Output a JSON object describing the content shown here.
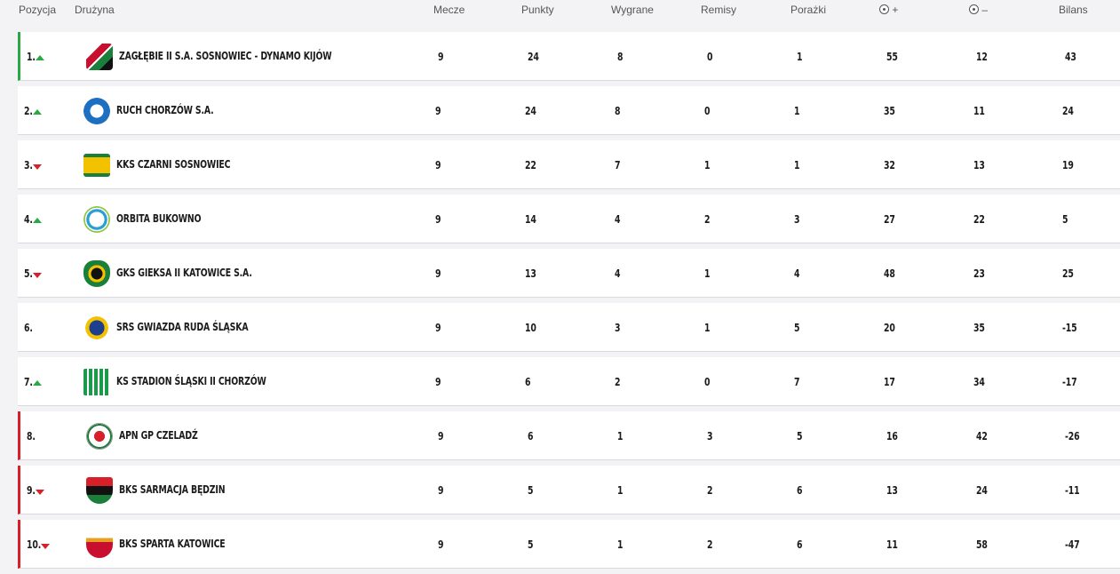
{
  "header": {
    "pozycja": "Pozycja",
    "druzyna": "Drużyna",
    "mecze": "Mecze",
    "punkty": "Punkty",
    "wygrane": "Wygrane",
    "remisy": "Remisy",
    "porazki": "Porażki",
    "goals_for": "+",
    "goals_against": "–",
    "bilans": "Bilans"
  },
  "rows": [
    {
      "pos": "1.",
      "trend": "up",
      "zone": "promo",
      "team": "ZAGŁĘBIE II S.A. SOSNOWIEC - DYNAMO KIJÓW",
      "logo": "zaglebie-logo",
      "mecze": "9",
      "punkty": "24",
      "wygrane": "8",
      "remisy": "0",
      "porazki": "1",
      "gplus": "55",
      "gminus": "12",
      "bilans": "43"
    },
    {
      "pos": "2.",
      "trend": "up",
      "zone": "",
      "team": "RUCH CHORZÓW S.A.",
      "logo": "ruch-logo",
      "mecze": "9",
      "punkty": "24",
      "wygrane": "8",
      "remisy": "0",
      "porazki": "1",
      "gplus": "35",
      "gminus": "11",
      "bilans": "24"
    },
    {
      "pos": "3.",
      "trend": "down",
      "zone": "",
      "team": "KKS CZARNI SOSNOWIEC",
      "logo": "czarni-logo",
      "mecze": "9",
      "punkty": "22",
      "wygrane": "7",
      "remisy": "1",
      "porazki": "1",
      "gplus": "32",
      "gminus": "13",
      "bilans": "19"
    },
    {
      "pos": "4.",
      "trend": "up",
      "zone": "",
      "team": "ORBITA BUKOWNO",
      "logo": "orbita-logo",
      "mecze": "9",
      "punkty": "14",
      "wygrane": "4",
      "remisy": "2",
      "porazki": "3",
      "gplus": "27",
      "gminus": "22",
      "bilans": "5"
    },
    {
      "pos": "5.",
      "trend": "down",
      "zone": "",
      "team": "GKS GIEKSA II KATOWICE S.A.",
      "logo": "gieksa-logo",
      "mecze": "9",
      "punkty": "13",
      "wygrane": "4",
      "remisy": "1",
      "porazki": "4",
      "gplus": "48",
      "gminus": "23",
      "bilans": "25"
    },
    {
      "pos": "6.",
      "trend": "",
      "zone": "",
      "team": "SRS GWIAZDA RUDA ŚLĄSKA",
      "logo": "gwiazda-logo",
      "mecze": "9",
      "punkty": "10",
      "wygrane": "3",
      "remisy": "1",
      "porazki": "5",
      "gplus": "20",
      "gminus": "35",
      "bilans": "-15"
    },
    {
      "pos": "7.",
      "trend": "up",
      "zone": "",
      "team": "KS STADION ŚLĄSKI II CHORZÓW",
      "logo": "stadion-logo",
      "mecze": "9",
      "punkty": "6",
      "wygrane": "2",
      "remisy": "0",
      "porazki": "7",
      "gplus": "17",
      "gminus": "34",
      "bilans": "-17"
    },
    {
      "pos": "8.",
      "trend": "",
      "zone": "releg",
      "team": "APN GP CZELADŹ",
      "logo": "apn-logo",
      "mecze": "9",
      "punkty": "6",
      "wygrane": "1",
      "remisy": "3",
      "porazki": "5",
      "gplus": "16",
      "gminus": "42",
      "bilans": "-26"
    },
    {
      "pos": "9.",
      "trend": "down",
      "zone": "releg",
      "team": "BKS SARMACJA BĘDZIN",
      "logo": "sarmacja-logo",
      "mecze": "9",
      "punkty": "5",
      "wygrane": "1",
      "remisy": "2",
      "porazki": "6",
      "gplus": "13",
      "gminus": "24",
      "bilans": "-11"
    },
    {
      "pos": "10.",
      "trend": "down",
      "zone": "releg",
      "team": "BKS SPARTA KATOWICE",
      "logo": "sparta-logo",
      "mecze": "9",
      "punkty": "5",
      "wygrane": "1",
      "remisy": "2",
      "porazki": "6",
      "gplus": "11",
      "gminus": "58",
      "bilans": "-47"
    }
  ],
  "colors": {
    "promotion": "#2aa845",
    "relegation": "#d8202a",
    "trend_up": "#2aa845",
    "trend_down": "#d8202a",
    "background": "#f3f3f5"
  }
}
